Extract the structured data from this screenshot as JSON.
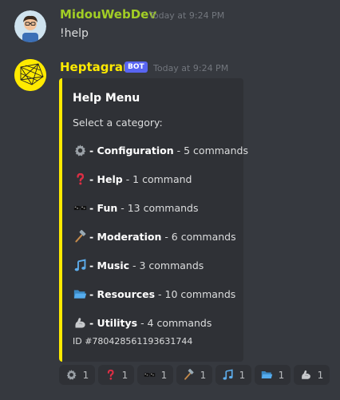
{
  "messages": [
    {
      "username": "MidouWebDev",
      "username_color": "#a2ce25",
      "timestamp": "Today at 9:24 PM",
      "text": "!help",
      "avatar_icon": "user-avatar-icon"
    },
    {
      "username": "Heptagram",
      "username_color": "#ffea00",
      "bot_badge": "BOT",
      "timestamp": "Today at 9:24 PM",
      "avatar_icon": "heptagram-avatar-icon",
      "embed": {
        "accent_color": "#ffea00",
        "title": "Help Menu",
        "description": "Select a category:",
        "categories": [
          {
            "icon": "gear-icon",
            "name": "- Configuration",
            "count": " - 5 commands"
          },
          {
            "icon": "question-icon",
            "name": "- Help",
            "count": " - 1 command"
          },
          {
            "icon": "glasses-icon",
            "name": "- Fun",
            "count": " - 13 commands"
          },
          {
            "icon": "hammer-icon",
            "name": "- Moderation",
            "count": " - 6 commands"
          },
          {
            "icon": "music-icon",
            "name": "- Music",
            "count": " - 3 commands"
          },
          {
            "icon": "folder-icon",
            "name": "- Resources",
            "count": " - 10 commands"
          },
          {
            "icon": "flexed-arm-icon",
            "name": "- Utilitys",
            "count": " - 4 commands"
          }
        ],
        "footer": "ID #780428561193631744"
      },
      "reactions": [
        {
          "icon": "gear-icon",
          "count": "1"
        },
        {
          "icon": "question-icon",
          "count": "1"
        },
        {
          "icon": "glasses-icon",
          "count": "1"
        },
        {
          "icon": "hammer-icon",
          "count": "1"
        },
        {
          "icon": "music-icon",
          "count": "1"
        },
        {
          "icon": "folder-icon",
          "count": "1"
        },
        {
          "icon": "flexed-arm-icon",
          "count": "1"
        }
      ]
    }
  ]
}
